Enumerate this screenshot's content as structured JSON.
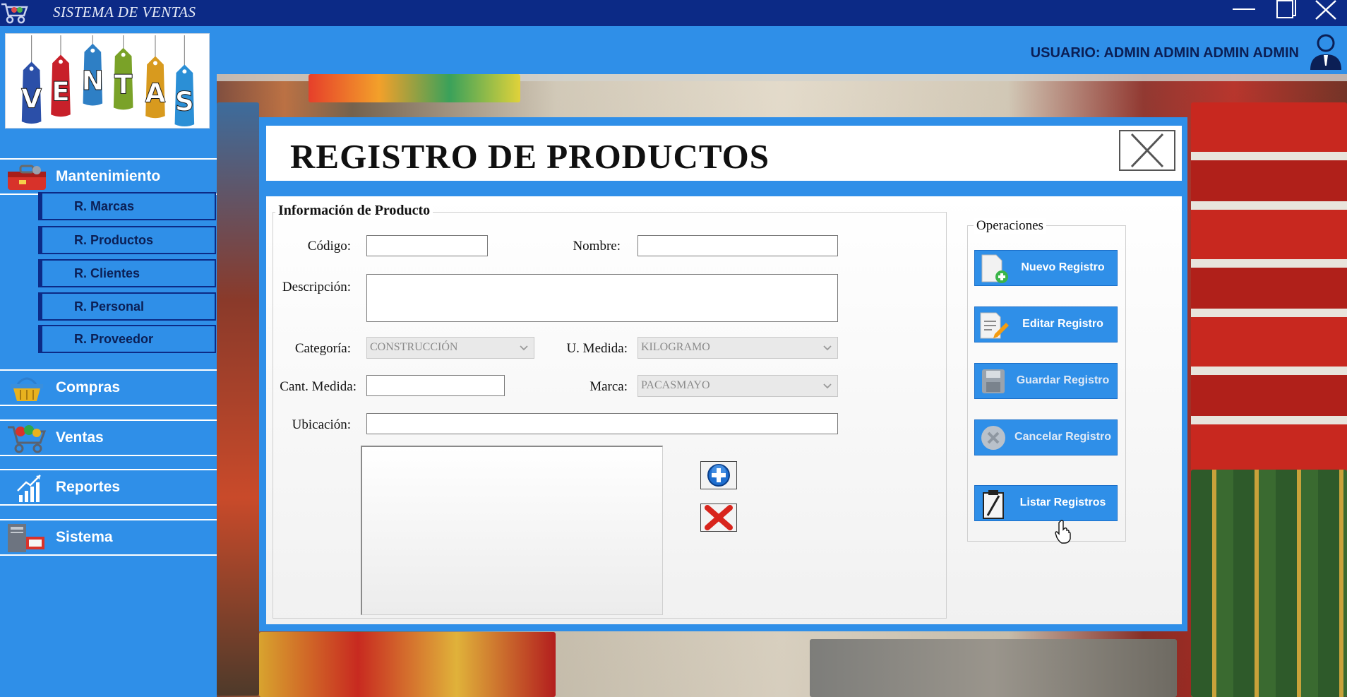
{
  "window": {
    "title": "SISTEMA DE VENTAS"
  },
  "logo": {
    "letters": [
      "V",
      "E",
      "N",
      "T",
      "A",
      "S"
    ],
    "tag_colors": [
      "#2b4fa8",
      "#c8202a",
      "#2e7fc5",
      "#7aa228",
      "#d89a1e",
      "#2b8fd6"
    ]
  },
  "user": {
    "label": "USUARIO: ADMIN ADMIN ADMIN ADMIN",
    "icon": "user-icon"
  },
  "sidebar": {
    "menu": [
      {
        "label": "Mantenimiento",
        "icon": "toolbox-icon"
      },
      {
        "label": "Compras",
        "icon": "basket-icon"
      },
      {
        "label": "Ventas",
        "icon": "shopping-cart-icon"
      },
      {
        "label": "Reportes",
        "icon": "bar-chart-icon"
      },
      {
        "label": "Sistema",
        "icon": "computer-icon"
      }
    ],
    "submenu": [
      {
        "label": "R. Marcas"
      },
      {
        "label": "R. Productos"
      },
      {
        "label": "R. Clientes"
      },
      {
        "label": "R. Personal"
      },
      {
        "label": "R. Proveedor"
      }
    ]
  },
  "dialog": {
    "title": "REGISTRO DE PRODUCTOS",
    "info_group": "Información de Producto",
    "ops_group": "Operaciones",
    "fields": {
      "codigo": {
        "label": "Código:",
        "value": ""
      },
      "nombre": {
        "label": "Nombre:",
        "value": ""
      },
      "descripcion": {
        "label": "Descripción:",
        "value": ""
      },
      "categoria": {
        "label": "Categoría:",
        "value": "CONSTRUCCIÓN"
      },
      "u_medida": {
        "label": "U. Medida:",
        "value": "KILOGRAMO"
      },
      "cant_medida": {
        "label": "Cant. Medida:",
        "value": ""
      },
      "marca": {
        "label": "Marca:",
        "value": "PACASMAYO"
      },
      "ubicacion": {
        "label": "Ubicación:",
        "value": ""
      }
    },
    "operations": [
      {
        "label": "Nuevo Registro",
        "icon": "new-document-icon"
      },
      {
        "label": "Editar Registro",
        "icon": "edit-document-icon"
      },
      {
        "label": "Guardar Registro",
        "icon": "save-icon"
      },
      {
        "label": "Cancelar Registro",
        "icon": "cancel-icon"
      },
      {
        "label": "Listar Registros",
        "icon": "clipboard-icon"
      }
    ],
    "image_actions": [
      {
        "icon": "add-circle-icon"
      },
      {
        "icon": "delete-x-icon"
      }
    ]
  },
  "colors": {
    "titlebar": "#0c2a86",
    "panel_blue": "#2f8fe8",
    "dark_text": "#0b1f55"
  }
}
